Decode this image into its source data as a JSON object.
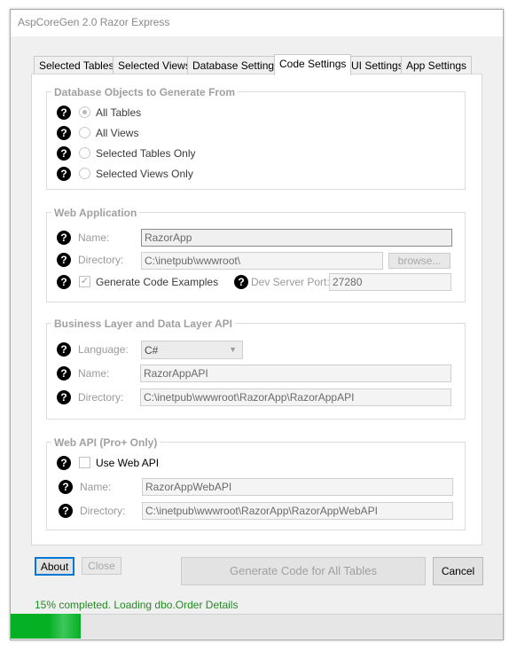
{
  "window": {
    "title": "AspCoreGen 2.0 Razor Express"
  },
  "tabs": [
    {
      "label": "Selected Tables",
      "active": false
    },
    {
      "label": "Selected Views",
      "active": false
    },
    {
      "label": "Database Settings",
      "active": false
    },
    {
      "label": "Code Settings",
      "active": true
    },
    {
      "label": "UI Settings",
      "active": false
    },
    {
      "label": "App Settings",
      "active": false
    }
  ],
  "db_objects": {
    "legend": "Database Objects to Generate From",
    "options": [
      {
        "label": "All Tables",
        "selected": true
      },
      {
        "label": "All Views",
        "selected": false
      },
      {
        "label": "Selected Tables Only",
        "selected": false
      },
      {
        "label": "Selected Views Only",
        "selected": false
      }
    ]
  },
  "web_app": {
    "legend": "Web Application",
    "name_label": "Name:",
    "name_value": "RazorApp",
    "directory_label": "Directory:",
    "directory_value": "C:\\inetpub\\wwwroot\\",
    "browse_label": "browse...",
    "generate_examples_label": "Generate Code Examples",
    "generate_examples_checked": true,
    "dev_port_label": "Dev Server Port:",
    "dev_port_value": "27280"
  },
  "business_layer": {
    "legend": "Business Layer and Data Layer API",
    "language_label": "Language:",
    "language_value": "C#",
    "name_label": "Name:",
    "name_value": "RazorAppAPI",
    "directory_label": "Directory:",
    "directory_value": "C:\\inetpub\\wwwroot\\RazorApp\\RazorAppAPI"
  },
  "web_api": {
    "legend": "Web API (Pro+ Only)",
    "use_label": "Use Web API",
    "use_checked": false,
    "name_label": "Name:",
    "name_value": "RazorAppWebAPI",
    "directory_label": "Directory:",
    "directory_value": "C:\\inetpub\\wwwroot\\RazorApp\\RazorAppWebAPI"
  },
  "help_glyph": "?",
  "buttons": {
    "about": "About",
    "close": "Close",
    "generate": "Generate Code for All Tables",
    "cancel": "Cancel"
  },
  "status": {
    "text": "15% completed.  Loading dbo.Order Details",
    "progress_fraction": 0.15,
    "progress_color": "#06b025"
  }
}
